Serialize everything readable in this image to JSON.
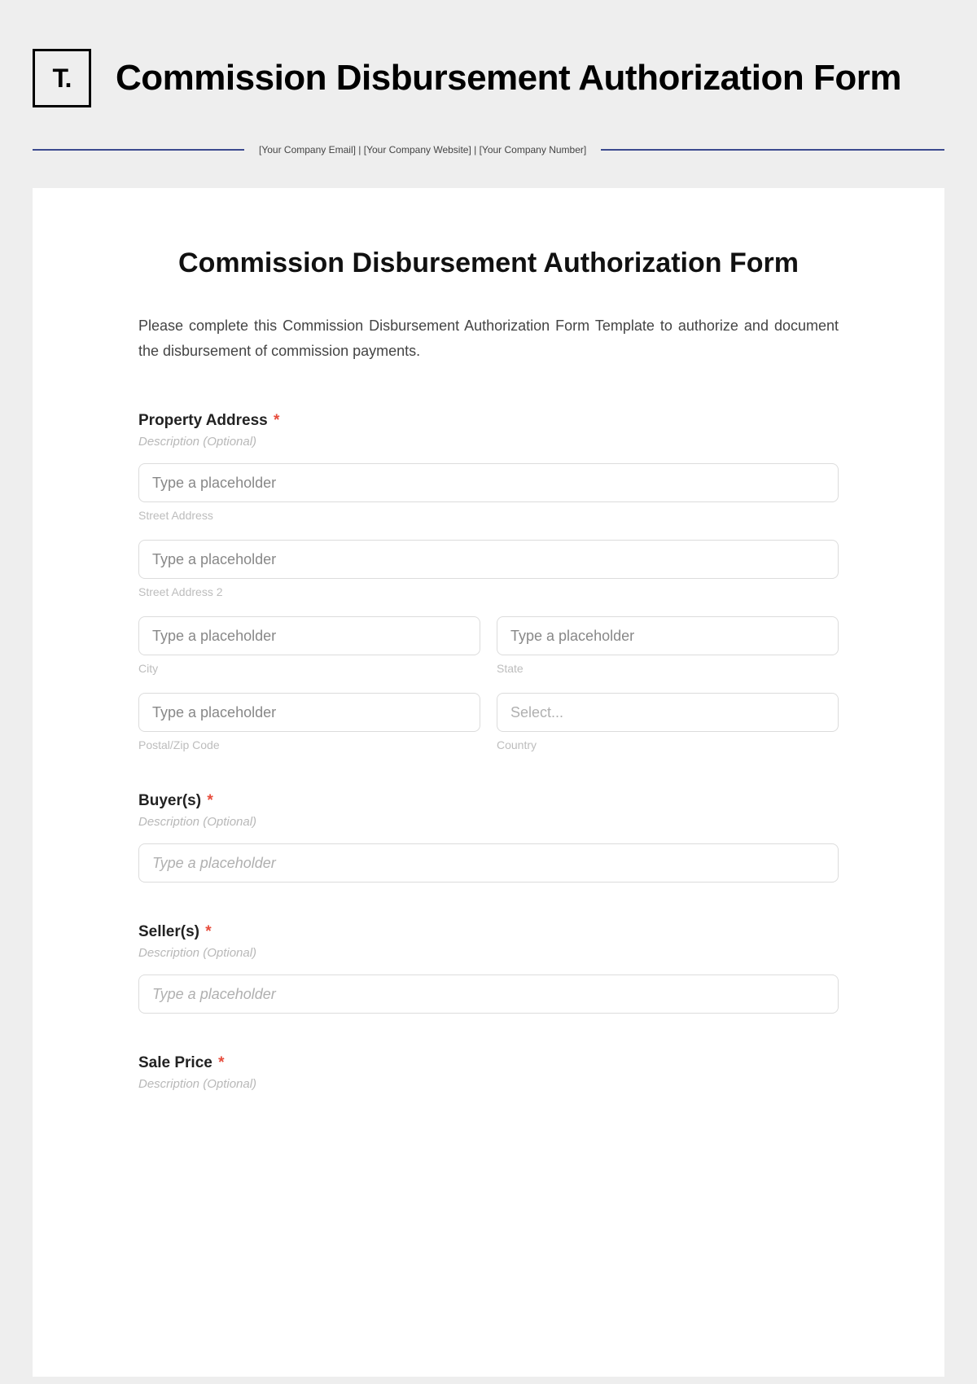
{
  "header": {
    "logo_text": "T.",
    "title": "Commission Disbursement Authorization Form",
    "company_info": "[Your Company Email]   |   [Your Company Website]    |   [Your Company Number]"
  },
  "form": {
    "heading": "Commission Disbursement Authorization Form",
    "intro": "Please complete this Commission Disbursement Authorization Form Template to authorize and document the disbursement of commission payments.",
    "sections": {
      "property_address": {
        "label": "Property Address",
        "description": "Description (Optional)",
        "fields": {
          "street1": {
            "placeholder": "Type a placeholder",
            "sublabel": "Street Address"
          },
          "street2": {
            "placeholder": "Type a placeholder",
            "sublabel": "Street Address 2"
          },
          "city": {
            "placeholder": "Type a placeholder",
            "sublabel": "City"
          },
          "state": {
            "placeholder": "Type a placeholder",
            "sublabel": "State"
          },
          "postal": {
            "placeholder": "Type a placeholder",
            "sublabel": "Postal/Zip Code"
          },
          "country": {
            "placeholder": "Select...",
            "sublabel": "Country"
          }
        }
      },
      "buyers": {
        "label": "Buyer(s)",
        "description": "Description (Optional)",
        "placeholder": "Type a placeholder"
      },
      "sellers": {
        "label": "Seller(s)",
        "description": "Description (Optional)",
        "placeholder": "Type a placeholder"
      },
      "sale_price": {
        "label": "Sale Price",
        "description": "Description (Optional)"
      }
    }
  }
}
